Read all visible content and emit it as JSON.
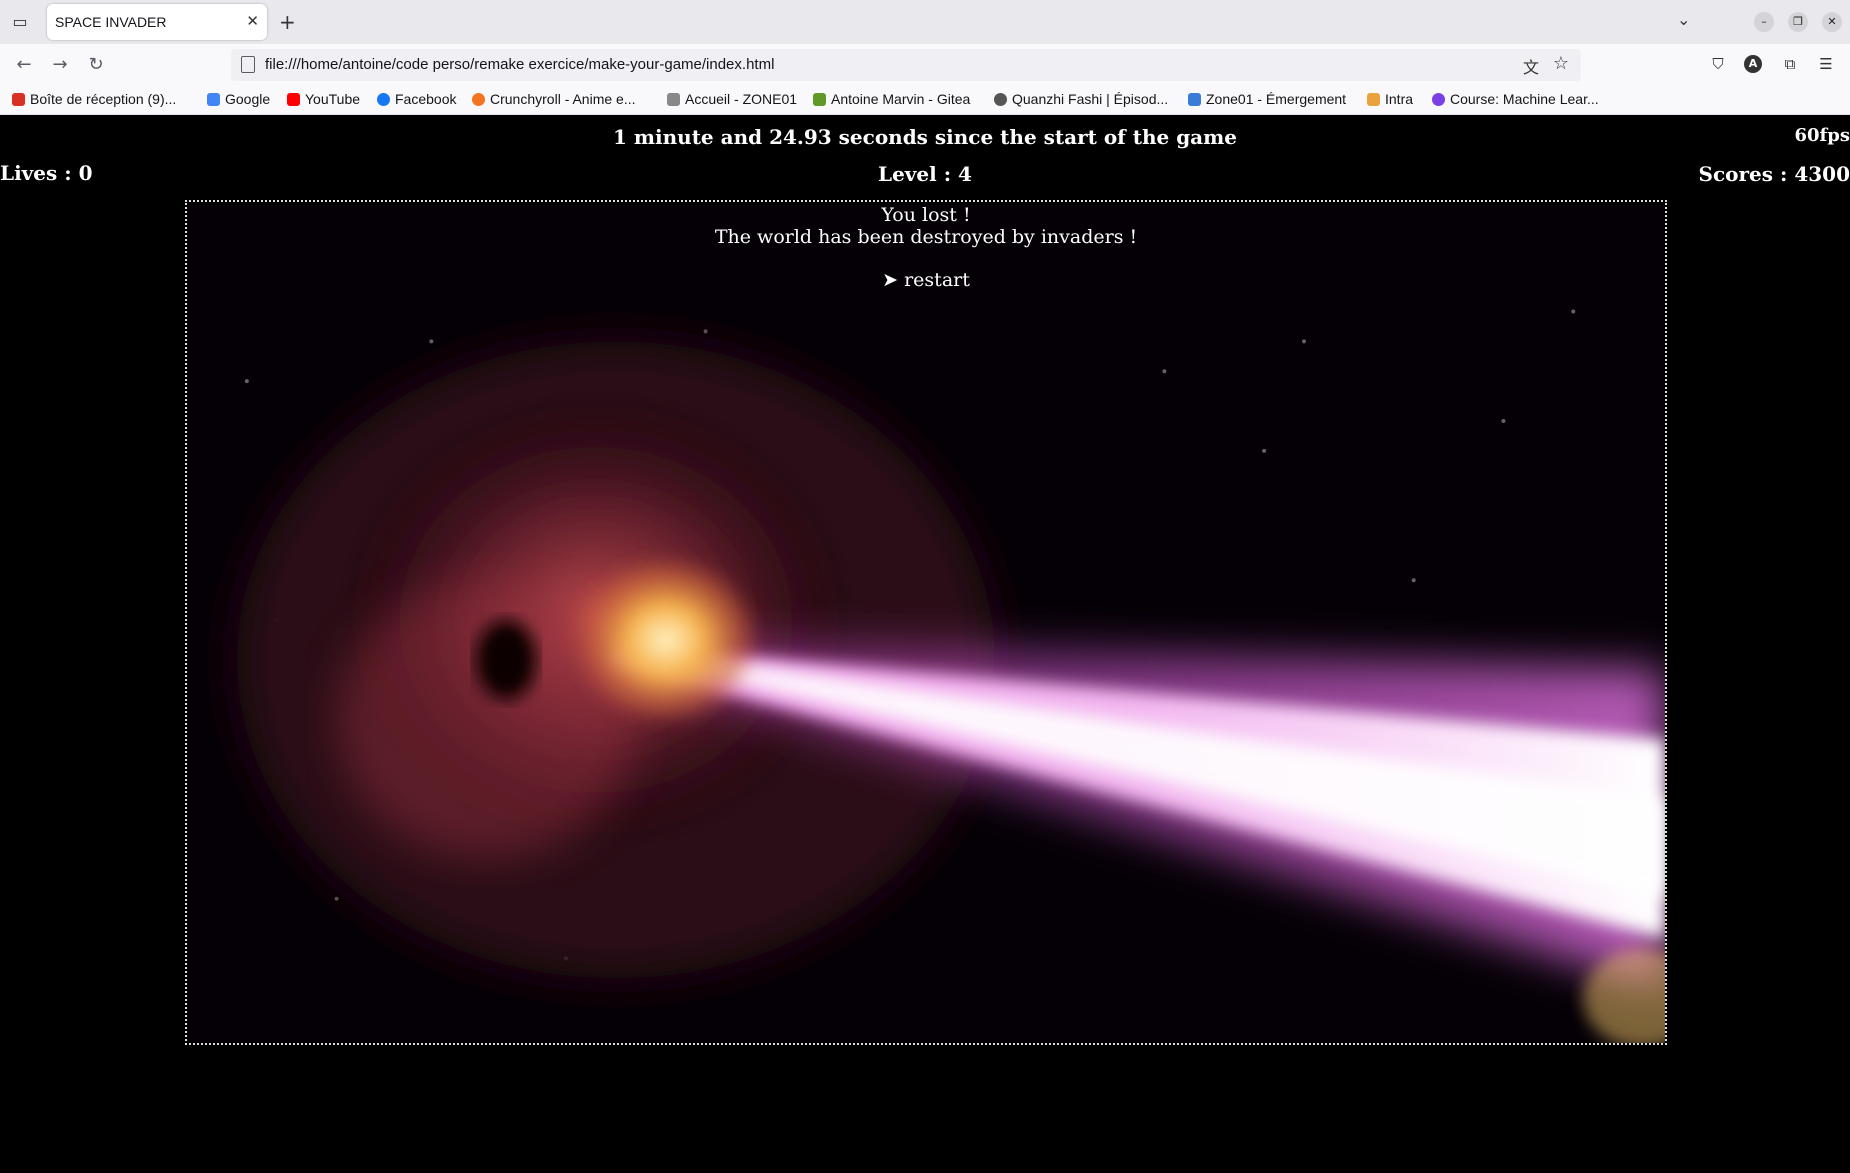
{
  "browser": {
    "tab_title": "SPACE INVADER",
    "url": "file:///home/antoine/code perso/remake exercice/make-your-game/index.html",
    "bookmarks": [
      {
        "label": "Boîte de réception (9)...",
        "color": "#d93025"
      },
      {
        "label": "Google",
        "color": "#4285f4"
      },
      {
        "label": "YouTube",
        "color": "#ff0000"
      },
      {
        "label": "Facebook",
        "color": "#1877f2"
      },
      {
        "label": "Crunchyroll - Anime e...",
        "color": "#f47521"
      },
      {
        "label": "Accueil - ZONE01",
        "color": "#888888"
      },
      {
        "label": "Antoine Marvin - Gitea",
        "color": "#609926"
      },
      {
        "label": "Quanzhi Fashi | Épisod...",
        "color": "#555555"
      },
      {
        "label": "Zone01 - Émergement",
        "color": "#3a7bd5"
      },
      {
        "label": "Intra",
        "color": "#e8a33d"
      },
      {
        "label": "Course: Machine Lear...",
        "color": "#7b3fe4"
      }
    ]
  },
  "game": {
    "timer": "1 minute and 24.93 seconds since the start of the game",
    "fps": "60fps",
    "lives": "Lives : 0",
    "level": "Level : 4",
    "scores": "Scores : 4300",
    "lost_title": "You lost !",
    "lost_message": "The world has been destroyed by invaders !",
    "restart": "➤ restart"
  }
}
